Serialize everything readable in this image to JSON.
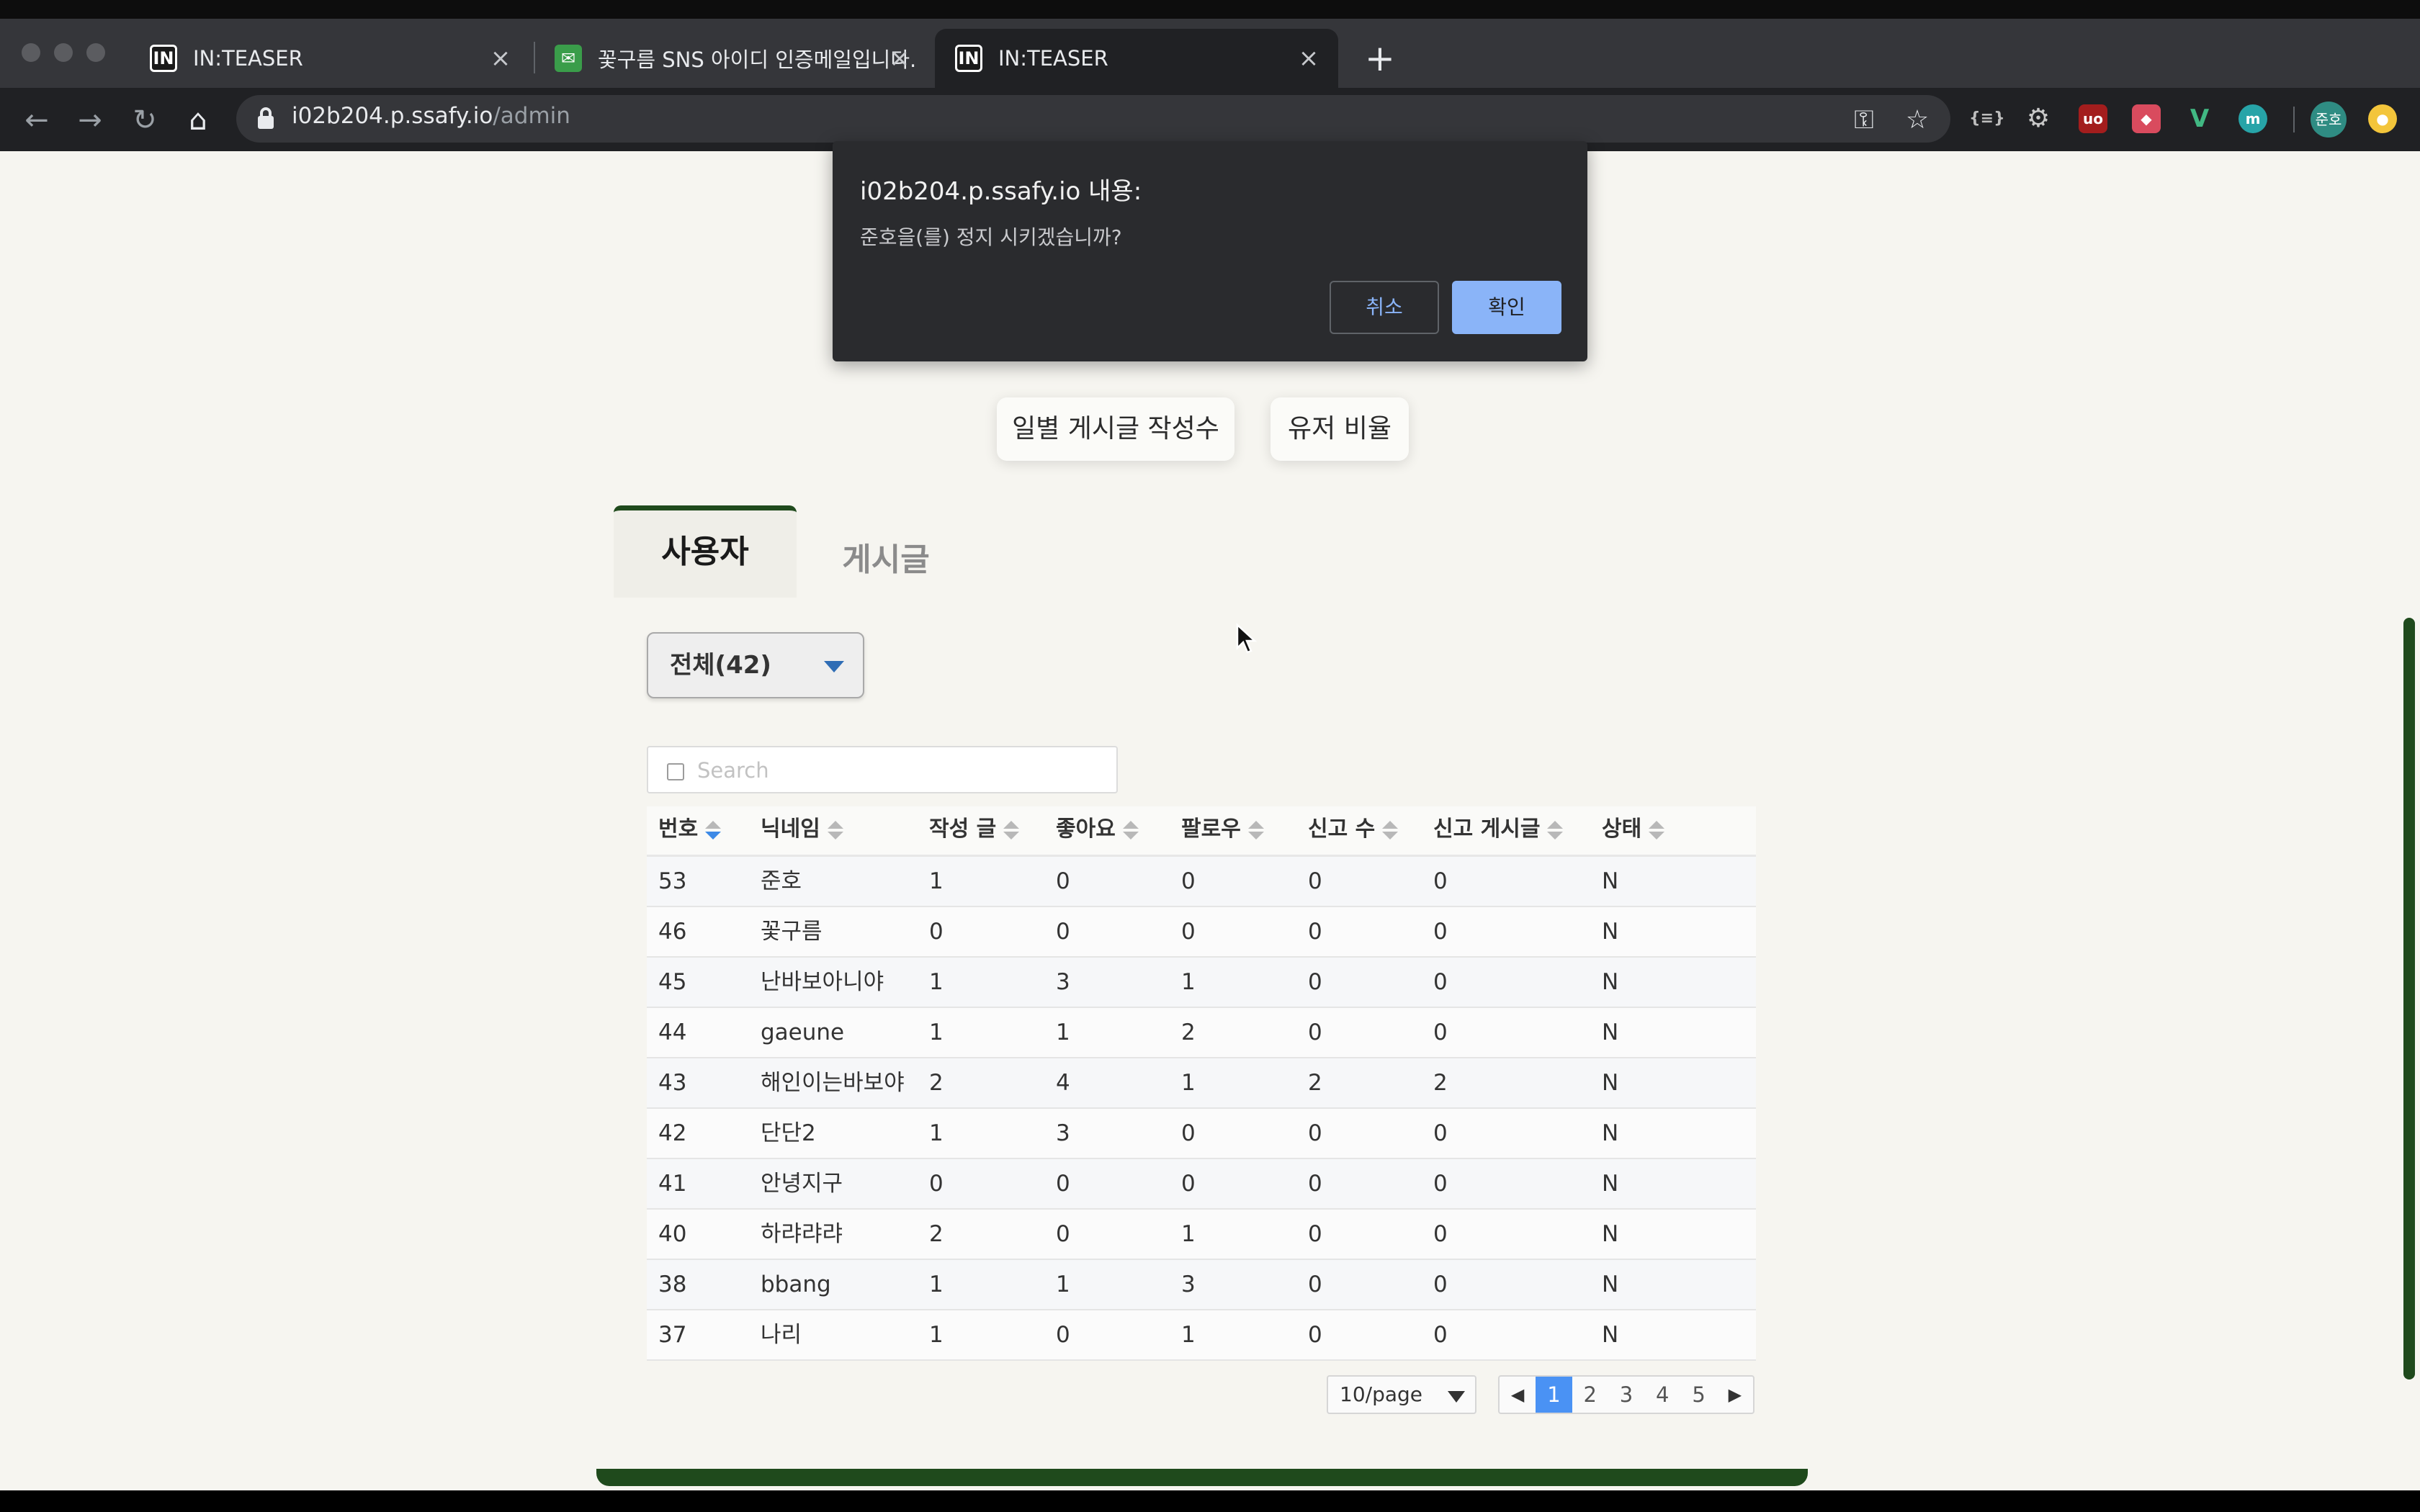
{
  "browser": {
    "tabs": [
      {
        "title": "IN:TEASER",
        "favicon": "in-teaser-logo"
      },
      {
        "title": "꽃구름 SNS 아이디 인증메일입니다.",
        "favicon": "mail-icon"
      },
      {
        "title": "IN:TEASER",
        "favicon": "in-teaser-logo"
      }
    ],
    "favicon_text": "IN",
    "url_host": "i02b204.p.ssafy.io",
    "url_path": "/admin",
    "profile_initials": "준호"
  },
  "dialog": {
    "title": "i02b204.p.ssafy.io 내용:",
    "message": "준호을(를) 정지 시키겠습니까?",
    "cancel_label": "취소",
    "ok_label": "확인"
  },
  "charts_buttons": {
    "daily_posts": "일별 게시글 작성수",
    "user_ratio": "유저 비율"
  },
  "tabs": {
    "users": "사용자",
    "posts": "게시글"
  },
  "filter": {
    "selected": "전체(42)"
  },
  "search": {
    "placeholder": "Search"
  },
  "table": {
    "columns": [
      "번호",
      "닉네임",
      "작성 글",
      "좋아요",
      "팔로우",
      "신고 수",
      "신고 게시글",
      "상태"
    ],
    "rows": [
      [
        "53",
        "준호",
        "1",
        "0",
        "0",
        "0",
        "0",
        "N"
      ],
      [
        "46",
        "꽃구름",
        "0",
        "0",
        "0",
        "0",
        "0",
        "N"
      ],
      [
        "45",
        "난바보아니야",
        "1",
        "3",
        "1",
        "0",
        "0",
        "N"
      ],
      [
        "44",
        "gaeune",
        "1",
        "1",
        "2",
        "0",
        "0",
        "N"
      ],
      [
        "43",
        "해인이는바보야",
        "2",
        "4",
        "1",
        "2",
        "2",
        "N"
      ],
      [
        "42",
        "단단2",
        "1",
        "3",
        "0",
        "0",
        "0",
        "N"
      ],
      [
        "41",
        "안녕지구",
        "0",
        "0",
        "0",
        "0",
        "0",
        "N"
      ],
      [
        "40",
        "하랴랴랴",
        "2",
        "0",
        "1",
        "0",
        "0",
        "N"
      ],
      [
        "38",
        "bbang",
        "1",
        "1",
        "3",
        "0",
        "0",
        "N"
      ],
      [
        "37",
        "나리",
        "1",
        "0",
        "1",
        "0",
        "0",
        "N"
      ]
    ]
  },
  "pagination": {
    "per_page": "10/page",
    "pages": [
      "1",
      "2",
      "3",
      "4",
      "5"
    ],
    "current": "1"
  },
  "colors": {
    "accent_green": "#1f4a1c",
    "page_active_blue": "#4a92f4",
    "dialog_button_blue": "#8ab4f8"
  }
}
